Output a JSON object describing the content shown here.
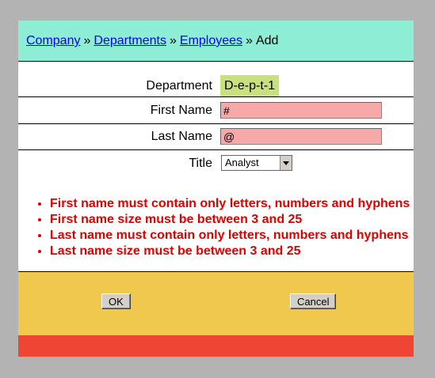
{
  "breadcrumb": {
    "items": [
      "Company",
      "Departments",
      "Employees"
    ],
    "separator": "»",
    "current": "Add"
  },
  "form": {
    "department_label": "Department",
    "department_value": "D-e-p-t-1",
    "first_name_label": "First Name",
    "first_name_value": "#",
    "last_name_label": "Last Name",
    "last_name_value": "@",
    "title_label": "Title",
    "title_value": "Analyst"
  },
  "errors": [
    "First name must contain only letters, numbers and hyphens",
    "First name size must be between 3 and 25",
    "Last name must contain only letters, numbers and hyphens",
    "Last name size must be between 3 and 25"
  ],
  "buttons": {
    "ok_label": "OK",
    "cancel_label": "Cancel"
  },
  "colors": {
    "header_bg": "#8eeed5",
    "department_bg": "#c8e07d",
    "invalid_input_bg": "#f7a8a8",
    "error_text": "#e00000",
    "footer_bg": "#f1c84e",
    "bottom_bar": "#ef4535"
  }
}
